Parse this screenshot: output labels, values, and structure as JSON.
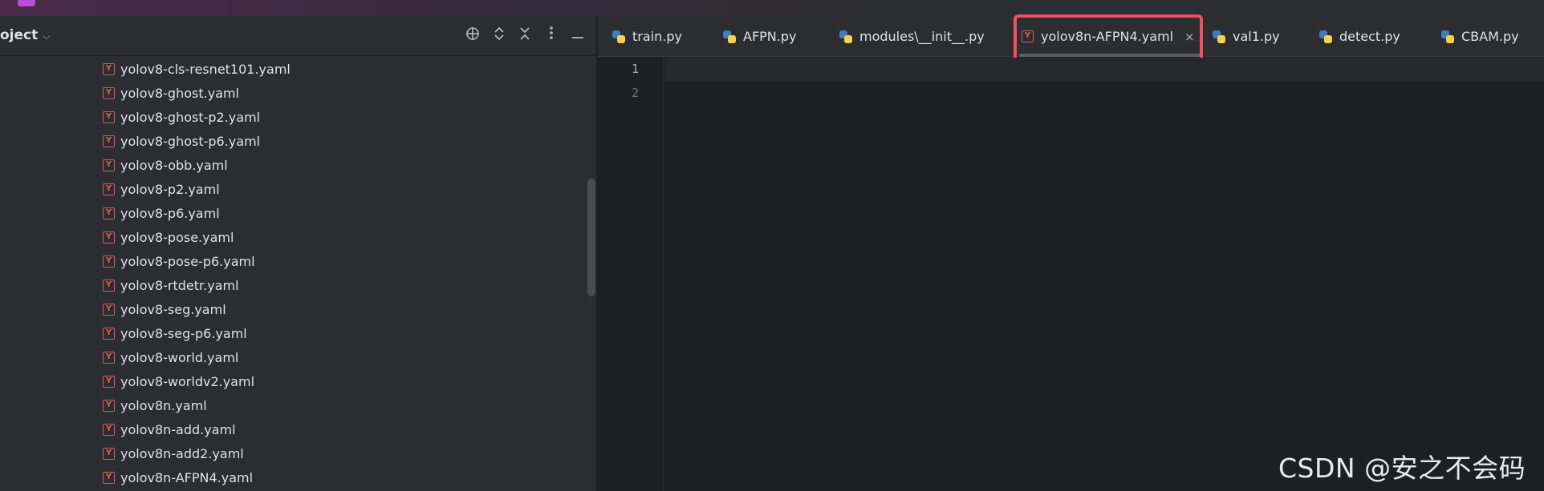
{
  "project": {
    "title": "oject",
    "header_icons": [
      "crosshair-icon",
      "expand-icon",
      "collapse-icon",
      "more-icon",
      "minimize-icon"
    ],
    "tree_items": [
      "yolov8-cls-resnet101.yaml",
      "yolov8-ghost.yaml",
      "yolov8-ghost-p2.yaml",
      "yolov8-ghost-p6.yaml",
      "yolov8-obb.yaml",
      "yolov8-p2.yaml",
      "yolov8-p6.yaml",
      "yolov8-pose.yaml",
      "yolov8-pose-p6.yaml",
      "yolov8-rtdetr.yaml",
      "yolov8-seg.yaml",
      "yolov8-seg-p6.yaml",
      "yolov8-world.yaml",
      "yolov8-worldv2.yaml",
      "yolov8n.yaml",
      "yolov8n-add.yaml",
      "yolov8n-add2.yaml",
      "yolov8n-AFPN4.yaml"
    ]
  },
  "editor": {
    "tabs": [
      {
        "label": "train.py",
        "type": "python"
      },
      {
        "label": "AFPN.py",
        "type": "python"
      },
      {
        "label": "modules\\__init__.py",
        "type": "python"
      },
      {
        "label": "yolov8n-AFPN4.yaml",
        "type": "yaml",
        "active": true
      },
      {
        "label": "val1.py",
        "type": "python"
      },
      {
        "label": "detect.py",
        "type": "python"
      },
      {
        "label": "CBAM.py",
        "type": "python"
      }
    ],
    "line_numbers": [
      "1",
      "2"
    ],
    "highlight_color": "#ee4f63"
  },
  "watermark": "CSDN @安之不会码",
  "icons": {
    "yaml_glyph": "Y",
    "close_glyph": "×",
    "chevron_glyph": "⌵"
  }
}
